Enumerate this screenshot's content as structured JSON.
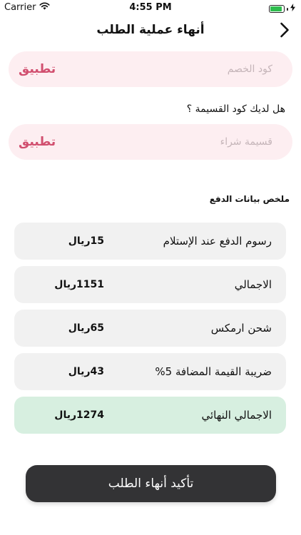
{
  "status_bar": {
    "carrier": "Carrier",
    "time": "4:55 PM",
    "battery_level": 0.9
  },
  "nav": {
    "title": "أنهاء عملية الطلب",
    "back_icon": "chevron-right-icon"
  },
  "discount": {
    "placeholder": "كود الخصم",
    "apply_label": "تطبيق"
  },
  "installment": {
    "question": "هل لديك كود القسيمة ؟",
    "placeholder": "قسيمة شراء",
    "apply_label": "تطبيق"
  },
  "summary": {
    "title": "ملخص بيانات الدفع",
    "rows": [
      {
        "label": "رسوم الدفع عند الإستلام",
        "value": "15ريال"
      },
      {
        "label": "الاجمالي",
        "value": "1151ريال"
      },
      {
        "label": "شحن ارمكس",
        "value": "65ريال"
      },
      {
        "label": "ضريبة القيمة المضافة 5%",
        "value": "43ريال"
      },
      {
        "label": "الاجمالي النهائي",
        "value": "1274ريال"
      }
    ]
  },
  "confirm": {
    "label": "تأكيد أنهاء الطلب"
  },
  "colors": {
    "accent": "#d14f6f",
    "input_bg": "#fdeef1",
    "row_bg": "#f1f1f1",
    "total_bg": "#d7efe0",
    "button_bg": "#333335"
  }
}
